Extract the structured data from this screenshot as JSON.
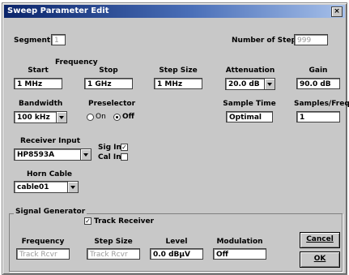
{
  "window": {
    "title": "Sweep Parameter Edit"
  },
  "segment": {
    "label": "Segment",
    "value": "1"
  },
  "steps": {
    "label": "Number of Steps",
    "value": "999"
  },
  "frequency": {
    "group_label": "Frequency",
    "start_label": "Start",
    "start_value": "1 MHz",
    "stop_label": "Stop",
    "stop_value": "1 GHz"
  },
  "step_size": {
    "label": "Step Size",
    "value": "1 MHz"
  },
  "attenuation": {
    "label": "Attenuation",
    "value": "20.0 dB"
  },
  "gain": {
    "label": "Gain",
    "value": "90.0 dB"
  },
  "bandwidth": {
    "label": "Bandwidth",
    "value": "100 kHz"
  },
  "preselector": {
    "label": "Preselector",
    "on_label": "On",
    "off_label": "Off",
    "selected": "Off"
  },
  "sample_time": {
    "label": "Sample Time",
    "value": "Optimal"
  },
  "samples_freq": {
    "label": "Samples/Freq",
    "value": "1"
  },
  "receiver_input": {
    "label": "Receiver Input",
    "value": "HP8593A"
  },
  "sig_in": {
    "label": "Sig In",
    "checked": true
  },
  "cal_in": {
    "label": "Cal In",
    "checked": false
  },
  "horn_cable": {
    "label": "Horn Cable",
    "value": "cable01"
  },
  "signal_generator": {
    "group_label": "Signal Generator",
    "track_receiver_label": "Track Receiver",
    "track_receiver_checked": true,
    "frequency_label": "Frequency",
    "frequency_value": "Track Rcvr",
    "step_size_label": "Step Size",
    "step_size_value": "Track Rcvr",
    "level_label": "Level",
    "level_value": "0.0 dBµV",
    "modulation_label": "Modulation",
    "modulation_value": "Off"
  },
  "buttons": {
    "cancel": "Cancel",
    "ok": "OK"
  }
}
